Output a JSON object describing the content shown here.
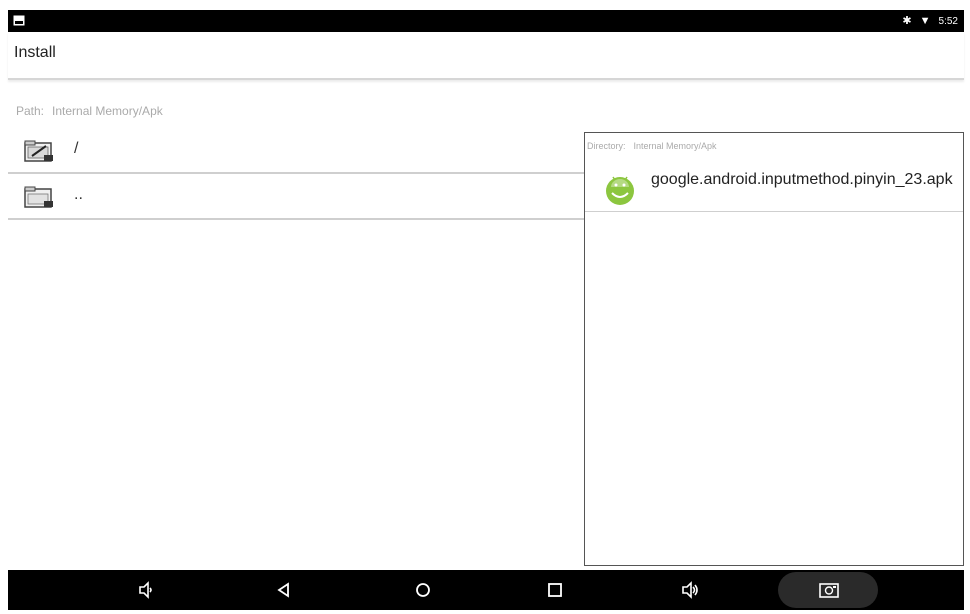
{
  "status_bar": {
    "time": "5:52"
  },
  "app_bar": {
    "title": "Install"
  },
  "path": {
    "label": "Path:",
    "value": "Internal Memory/Apk"
  },
  "left_items": [
    {
      "label": "/",
      "icon": "folder-edit-icon"
    },
    {
      "label": "..",
      "icon": "folder-up-icon"
    }
  ],
  "right_panel": {
    "directory_label": "Directory:",
    "directory_value": "Internal Memory/Apk",
    "files": [
      {
        "name": "google.android.inputmethod.pinyin_23.apk",
        "icon": "android-apk-icon"
      }
    ]
  },
  "colors": {
    "android_green": "#8cc63f",
    "bar_black": "#000000"
  }
}
